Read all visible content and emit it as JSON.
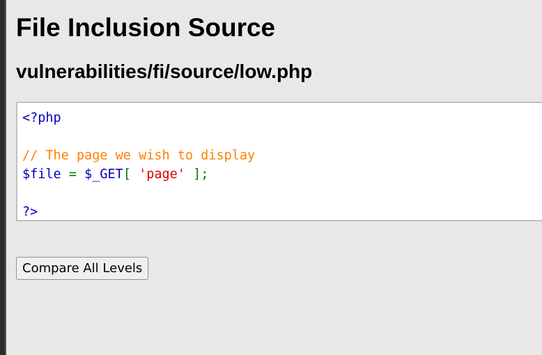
{
  "page": {
    "title": "File Inclusion Source",
    "path": "vulnerabilities/fi/source/low.php"
  },
  "code": {
    "open_tag": "<?php",
    "comment": "// The page we wish to display",
    "var_file": "$file",
    "assign": " = ",
    "var_get": "$_GET",
    "bracket_open": "[ ",
    "string_page": "'page'",
    "bracket_close": " ];",
    "close_tag": "?>"
  },
  "buttons": {
    "compare_label": "Compare All Levels"
  },
  "colors": {
    "default": "#0000bb",
    "comment": "#ff8000",
    "keyword": "#007700",
    "string": "#dd0000"
  }
}
